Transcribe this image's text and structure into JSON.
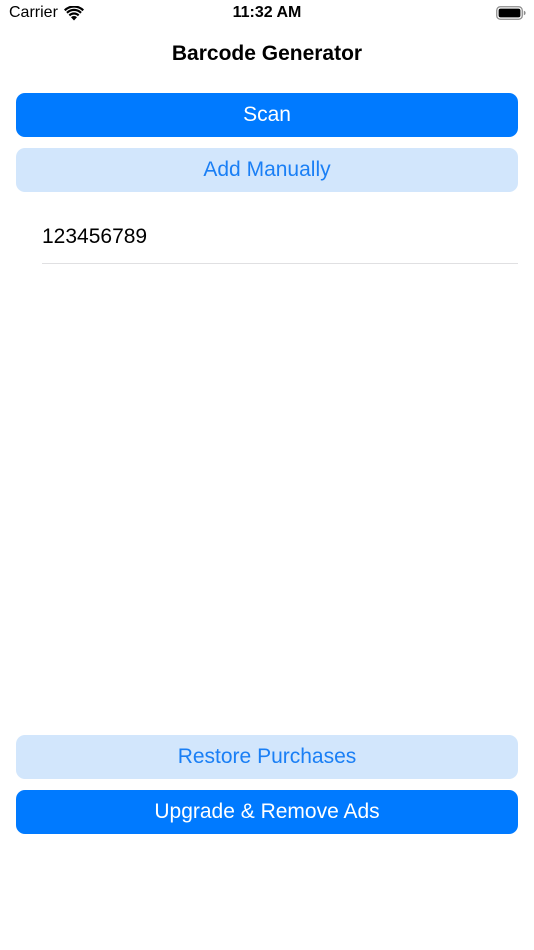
{
  "status_bar": {
    "carrier": "Carrier",
    "time": "11:32 AM",
    "wifi_icon": "wifi-icon",
    "battery_icon": "battery-icon"
  },
  "header": {
    "title": "Barcode Generator"
  },
  "actions": {
    "scan_label": "Scan",
    "add_manually_label": "Add Manually"
  },
  "barcodes": [
    {
      "value": "123456789"
    }
  ],
  "footer": {
    "restore_label": "Restore Purchases",
    "upgrade_label": "Upgrade & Remove Ads"
  },
  "colors": {
    "accent": "#007aff",
    "secondary_bg": "#d2e6fc",
    "secondary_text": "#1a7ff5"
  }
}
